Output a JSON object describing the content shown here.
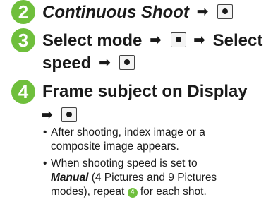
{
  "steps": [
    {
      "number": "2",
      "line1_italic": "Continuous Shoot"
    },
    {
      "number": "3",
      "line1_a": "Select mode",
      "line1_b": "Select",
      "line2": "speed"
    },
    {
      "number": "4",
      "line1": "Frame subject on Display"
    }
  ],
  "notes": [
    {
      "line1": "After shooting, index image or a",
      "line2": "composite image appears."
    },
    {
      "line1": "When shooting speed is set to",
      "emphasis": "Manual",
      "line2_rest": " (4 Pictures and 9 Pictures",
      "line3_a": "modes), repeat ",
      "line3_b": " for each shot.",
      "step_ref": "4"
    }
  ],
  "icons": {
    "arrow": "right-arrow-icon",
    "center_key": "center-key-icon"
  },
  "colors": {
    "accent": "#6fbf3c"
  }
}
